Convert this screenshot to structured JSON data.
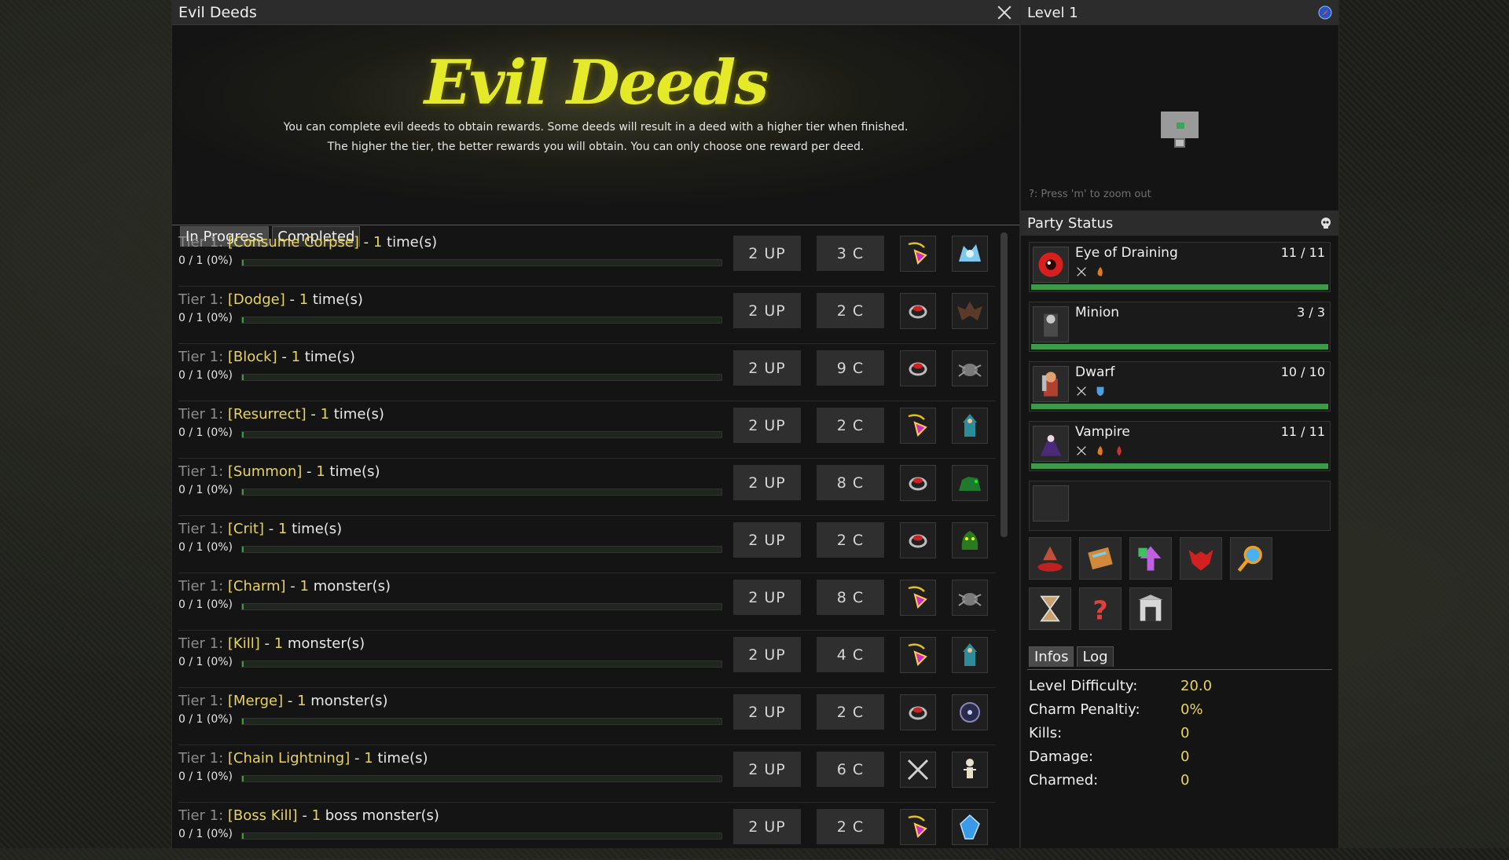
{
  "deeds_window": {
    "title": "Evil Deeds",
    "logo_text": "Evil Deeds",
    "intro": [
      "You can complete evil deeds to obtain rewards. Some deeds will result in a deed with a higher tier when finished.",
      "The higher the tier, the better rewards you will obtain. You can only choose one reward per deed."
    ],
    "tabs": [
      {
        "label": "In Progress",
        "active": true
      },
      {
        "label": "Completed",
        "active": false
      }
    ],
    "deeds": [
      {
        "tier": "Tier 1:",
        "name": "[Consume Corpse]",
        "sep": " - ",
        "count": "1",
        "unit": " time(s)",
        "progress": "0 / 1 (0%)",
        "up": "2 UP",
        "c": "3 C",
        "icon1": "amulet-icon",
        "icon2": "ghost-dragon-icon"
      },
      {
        "tier": "Tier 1:",
        "name": "[Dodge]",
        "sep": " - ",
        "count": "1",
        "unit": " time(s)",
        "progress": "0 / 1 (0%)",
        "up": "2 UP",
        "c": "2 C",
        "icon1": "ring-icon",
        "icon2": "bat-icon"
      },
      {
        "tier": "Tier 1:",
        "name": "[Block]",
        "sep": " - ",
        "count": "1",
        "unit": " time(s)",
        "progress": "0 / 1 (0%)",
        "up": "2 UP",
        "c": "9 C",
        "icon1": "ring-icon",
        "icon2": "spider-icon"
      },
      {
        "tier": "Tier 1:",
        "name": "[Resurrect]",
        "sep": " - ",
        "count": "1",
        "unit": " time(s)",
        "progress": "0 / 1 (0%)",
        "up": "2 UP",
        "c": "2 C",
        "icon1": "amulet-icon",
        "icon2": "mage-icon"
      },
      {
        "tier": "Tier 1:",
        "name": "[Summon]",
        "sep": " - ",
        "count": "1",
        "unit": " time(s)",
        "progress": "0 / 1 (0%)",
        "up": "2 UP",
        "c": "8 C",
        "icon1": "ring-icon",
        "icon2": "beast-icon"
      },
      {
        "tier": "Tier 1:",
        "name": "[Crit]",
        "sep": " - ",
        "count": "1",
        "unit": " time(s)",
        "progress": "0 / 1 (0%)",
        "up": "2 UP",
        "c": "2 C",
        "icon1": "ring-icon",
        "icon2": "plant-monster-icon"
      },
      {
        "tier": "Tier 1:",
        "name": "[Charm]",
        "sep": " - ",
        "count": "1",
        "unit": " monster(s)",
        "progress": "0 / 1 (0%)",
        "up": "2 UP",
        "c": "8 C",
        "icon1": "amulet-icon",
        "icon2": "spider-icon"
      },
      {
        "tier": "Tier 1:",
        "name": "[Kill]",
        "sep": " - ",
        "count": "1",
        "unit": " monster(s)",
        "progress": "0 / 1 (0%)",
        "up": "2 UP",
        "c": "4 C",
        "icon1": "amulet-icon",
        "icon2": "mage-icon"
      },
      {
        "tier": "Tier 1:",
        "name": "[Merge]",
        "sep": " - ",
        "count": "1",
        "unit": " monster(s)",
        "progress": "0 / 1 (0%)",
        "up": "2 UP",
        "c": "2 C",
        "icon1": "ring-icon",
        "icon2": "orb-icon"
      },
      {
        "tier": "Tier 1:",
        "name": "[Chain Lightning]",
        "sep": " - ",
        "count": "1",
        "unit": " time(s)",
        "progress": "0 / 1 (0%)",
        "up": "2 UP",
        "c": "6 C",
        "icon1": "crossed-swords-icon",
        "icon2": "skeleton-icon"
      },
      {
        "tier": "Tier 1:",
        "name": "[Boss Kill]",
        "sep": " - ",
        "count": "1",
        "unit": " boss monster(s)",
        "progress": "0 / 1 (0%)",
        "up": "2 UP",
        "c": "2 C",
        "icon1": "amulet-icon",
        "icon2": "crystal-icon"
      }
    ]
  },
  "level_panel": {
    "title": "Level 1",
    "minimap_hint": "?: Press 'm' to zoom out"
  },
  "party": {
    "title": "Party Status",
    "members": [
      {
        "name": "Eye of Draining",
        "hp": "11 / 11",
        "hp_fraction": 1.0,
        "portrait": "eye-icon",
        "tags": [
          "crossed-swords-icon",
          "fire-icon"
        ]
      },
      {
        "name": "Minion",
        "hp": "3 / 3",
        "hp_fraction": 1.0,
        "portrait": "minion-icon",
        "tags": []
      },
      {
        "name": "Dwarf",
        "hp": "10 / 10",
        "hp_fraction": 1.0,
        "portrait": "dwarf-icon",
        "tags": [
          "crossed-swords-icon",
          "shield-icon"
        ]
      },
      {
        "name": "Vampire",
        "hp": "11 / 11",
        "hp_fraction": 1.0,
        "portrait": "vampire-icon",
        "tags": [
          "crossed-swords-icon",
          "fire-icon",
          "blood-icon"
        ]
      }
    ],
    "abilities": [
      "summon-icon",
      "spellbook-icon",
      "level-up-icon",
      "demon-icon",
      "magnify-icon",
      "hourglass-icon",
      "mystery-icon",
      "altar-icon"
    ]
  },
  "infos": {
    "tabs": [
      {
        "label": "Infos",
        "active": true
      },
      {
        "label": "Log",
        "active": false
      }
    ],
    "rows": [
      {
        "label": "Level Difficulty:",
        "value": "20.0"
      },
      {
        "label": "Charm Penaltiy:",
        "value": "0%"
      },
      {
        "label": "Kills:",
        "value": "0"
      },
      {
        "label": "Damage:",
        "value": "0"
      },
      {
        "label": "Charmed:",
        "value": "0"
      }
    ]
  },
  "colors": {
    "accent_yellow": "#e9d45a",
    "logo_yellow": "#e4ea2a",
    "hp_green": "#3c9a4a"
  }
}
